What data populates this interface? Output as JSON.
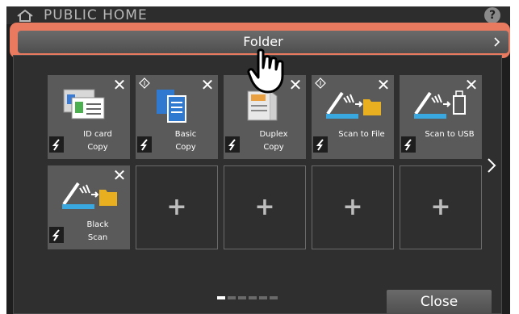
{
  "topbar": {
    "title": "PUBLIC HOME",
    "help_label": "?"
  },
  "folder_bar": {
    "label": "Folder"
  },
  "tiles": [
    {
      "line1": "ID card",
      "line2": "Copy",
      "icon": "id-card-copy-icon"
    },
    {
      "line1": "Basic",
      "line2": "Copy",
      "icon": "basic-copy-icon"
    },
    {
      "line1": "Duplex",
      "line2": "Copy",
      "icon": "duplex-copy-icon"
    },
    {
      "line1": "Scan to File",
      "line2": "",
      "icon": "scan-to-file-icon"
    },
    {
      "line1": "Scan to USB",
      "line2": "",
      "icon": "scan-to-usb-icon"
    },
    {
      "line1": "Black",
      "line2": "Scan",
      "icon": "black-scan-icon"
    }
  ],
  "empty_slot_label": "+",
  "close_label": "Close",
  "page_indicator": {
    "pages": 6,
    "current": 1
  },
  "colors": {
    "highlight": "#e97a5f",
    "panel": "#2f2f2f",
    "tile": "#5a5a5a"
  }
}
